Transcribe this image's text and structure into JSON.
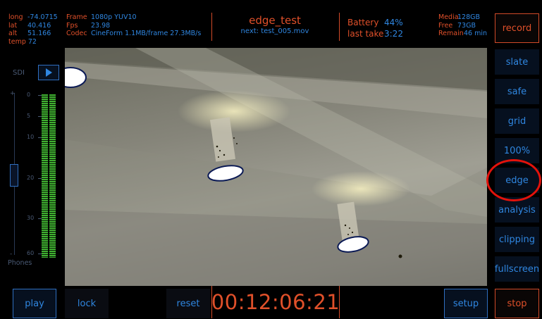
{
  "geo": {
    "long": {
      "label": "long",
      "value": "-74.0715"
    },
    "lat": {
      "label": "lat",
      "value": "40.416"
    },
    "alt": {
      "label": "alt",
      "value": "51.166"
    },
    "temp": {
      "label": "temp",
      "value": "72"
    }
  },
  "format": {
    "frame": {
      "label": "Frame",
      "value": "1080p YUV10"
    },
    "fps": {
      "label": "Fps",
      "value": "23.98"
    },
    "codec": {
      "label": "Codec",
      "value": "CineForm 1.1MB/frame 27.3MB/s"
    }
  },
  "clip": {
    "name": "edge_test",
    "next": "next: test_005.mov"
  },
  "battery": {
    "battery": {
      "label": "Battery",
      "value": "44%"
    },
    "last_take": {
      "label": "last take",
      "value": "3:22"
    }
  },
  "media": {
    "media": {
      "label": "Media",
      "value": "128GB"
    },
    "free": {
      "label": "Free",
      "value": "73GB"
    },
    "remain": {
      "label": "Remain",
      "value": "46 min"
    }
  },
  "buttons": {
    "record": "record",
    "stop": "stop",
    "play": "play",
    "lock": "lock",
    "reset": "reset",
    "setup": "setup"
  },
  "right_menu": [
    {
      "key": "slate",
      "label": "slate"
    },
    {
      "key": "safe",
      "label": "safe"
    },
    {
      "key": "grid",
      "label": "grid"
    },
    {
      "key": "zoom",
      "label": "100%"
    },
    {
      "key": "edge",
      "label": "edge"
    },
    {
      "key": "analysis",
      "label": "analysis"
    },
    {
      "key": "clipping",
      "label": "clipping"
    },
    {
      "key": "fullscreen",
      "label": "fullscreen"
    }
  ],
  "audio": {
    "sdi_label": "SDI",
    "phones_label": "Phones",
    "ticks": [
      "0",
      "5",
      "10",
      "20",
      "30",
      "60"
    ],
    "plus": "+",
    "minus": "-"
  },
  "timecode": "00:12:06:21",
  "colors": {
    "accent_orange": "#e0502a",
    "accent_blue": "#2f86e0",
    "meter_green": "#3fb030",
    "annotation_red": "#e3120b"
  }
}
